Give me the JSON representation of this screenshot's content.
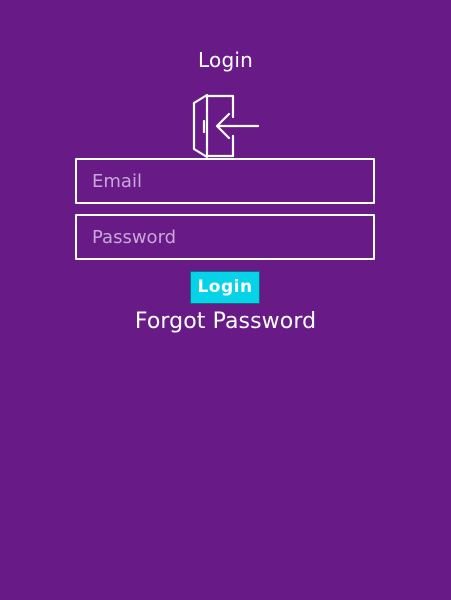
{
  "header": {
    "title": "Login"
  },
  "icons": {
    "login": "login-door-arrow-icon"
  },
  "form": {
    "email": {
      "placeholder": "Email",
      "value": ""
    },
    "password": {
      "placeholder": "Password",
      "value": ""
    },
    "login_button_label": "Login",
    "forgot_password_link": "Forgot Password"
  },
  "colors": {
    "background": "#681a86",
    "button": "#07d3e8",
    "text": "#ffffff",
    "placeholder": "#c9a7d8"
  }
}
